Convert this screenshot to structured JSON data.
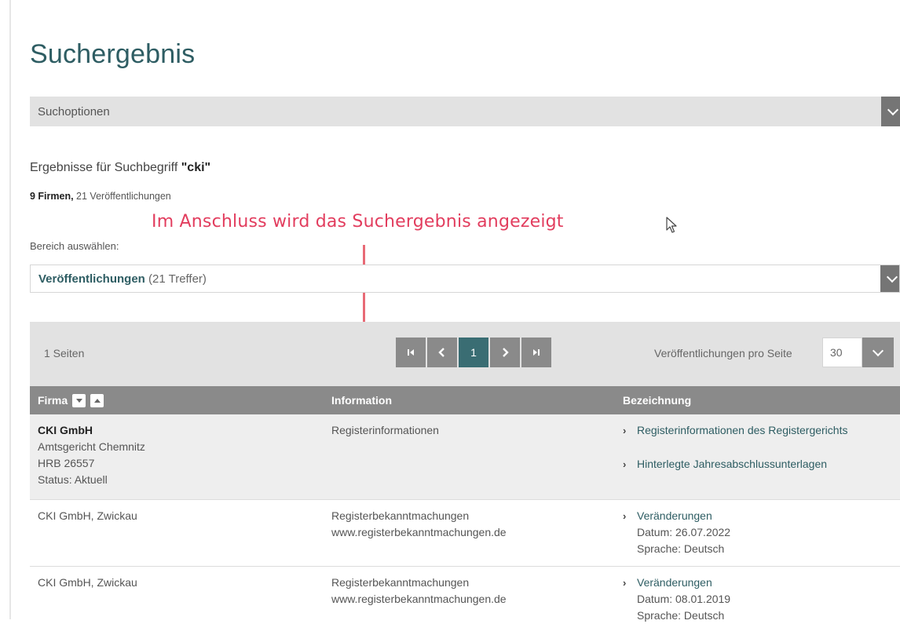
{
  "page": {
    "title": "Suchergebnis",
    "search_options_label": "Suchoptionen",
    "result_prefix": "Ergebnisse für Suchbegriff ",
    "search_term": "\"cki\"",
    "firms_count": "9 Firmen,",
    "publications_count": " 21 Veröffentlichungen",
    "annotation": "Im Anschluss wird das Suchergebnis angezeigt",
    "area_label": "Bereich auswählen:",
    "area_value": "Veröffentlichungen",
    "area_hits": " (21 Treffer)"
  },
  "pagination": {
    "pages_text": "1 Seiten",
    "first": "⏮",
    "prev": "‹",
    "current": "1",
    "next": "›",
    "last": "⏭",
    "per_page_label": "Veröffentlichungen pro Seite",
    "per_page_value": "30"
  },
  "table": {
    "headers": [
      "Firma",
      "Information",
      "Bezeichnung"
    ],
    "rows": [
      {
        "firma_name": "CKI GmbH",
        "firma_court": "Amtsgericht Chemnitz",
        "firma_hrb": "HRB 26557",
        "firma_status": "Status:  Aktuell",
        "info": "Registerinformationen",
        "links": [
          "Registerinformationen des Registergerichts",
          "Hinterlegte Jahresabschlussunterlagen"
        ]
      },
      {
        "firma": "CKI GmbH, Zwickau",
        "info1": "Registerbekanntmachungen",
        "info2": "www.registerbekanntmachungen.de",
        "link": "Veränderungen",
        "datum": "Datum: 26.07.2022",
        "sprache": "Sprache: Deutsch"
      },
      {
        "firma": "CKI GmbH, Zwickau",
        "info1": "Registerbekanntmachungen",
        "info2": "www.registerbekanntmachungen.de",
        "link": "Veränderungen",
        "datum": "Datum: 08.01.2019",
        "sprache": "Sprache: Deutsch"
      }
    ]
  },
  "colors": {
    "title": "#2e5d63",
    "annotation": "#e23d5e",
    "header_bar": "#8a8a8a",
    "active_page": "#3a6d73"
  },
  "icons": [
    "chevron-down-icon",
    "first-page-icon",
    "prev-page-icon",
    "next-page-icon",
    "last-page-icon",
    "sort-down-icon",
    "sort-up-icon",
    "mouse-cursor-icon",
    "arrow-annotation"
  ]
}
